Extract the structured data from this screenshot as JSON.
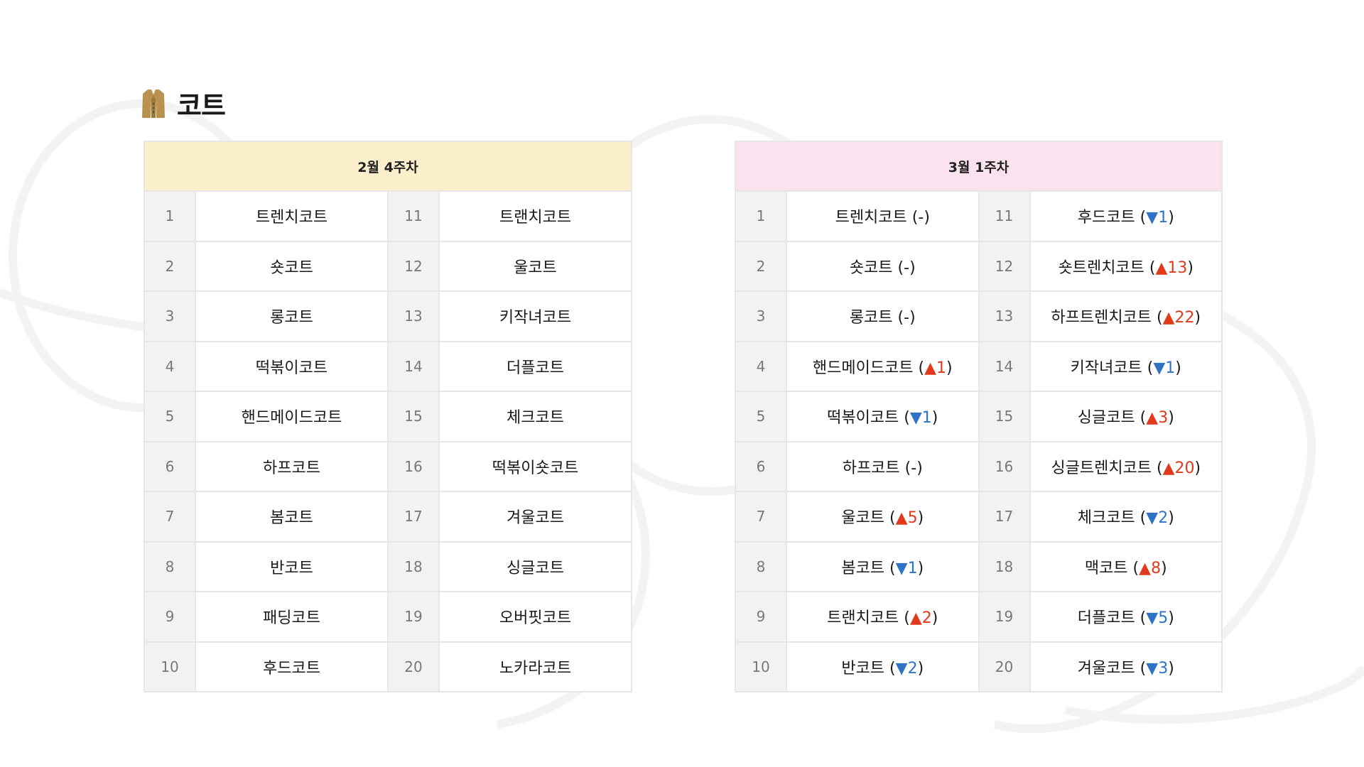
{
  "page": {
    "title": "코트",
    "icon": "coat-icon"
  },
  "colors": {
    "left_header_bg": "#fcf0cc",
    "right_header_bg": "#fae3ee",
    "up": "#e0391c",
    "down": "#2f73c4"
  },
  "left_table": {
    "header": "2월 4주차",
    "rows": [
      {
        "rank": "1",
        "name": "트렌치코트"
      },
      {
        "rank": "2",
        "name": "숏코트"
      },
      {
        "rank": "3",
        "name": "롱코트"
      },
      {
        "rank": "4",
        "name": "떡볶이코트"
      },
      {
        "rank": "5",
        "name": "핸드메이드코트"
      },
      {
        "rank": "6",
        "name": "하프코트"
      },
      {
        "rank": "7",
        "name": "봄코트"
      },
      {
        "rank": "8",
        "name": "반코트"
      },
      {
        "rank": "9",
        "name": "패딩코트"
      },
      {
        "rank": "10",
        "name": "후드코트"
      },
      {
        "rank": "11",
        "name": "트랜치코트"
      },
      {
        "rank": "12",
        "name": "울코트"
      },
      {
        "rank": "13",
        "name": "키작녀코트"
      },
      {
        "rank": "14",
        "name": "더플코트"
      },
      {
        "rank": "15",
        "name": "체크코트"
      },
      {
        "rank": "16",
        "name": "떡볶이숏코트"
      },
      {
        "rank": "17",
        "name": "겨울코트"
      },
      {
        "rank": "18",
        "name": "싱글코트"
      },
      {
        "rank": "19",
        "name": "오버핏코트"
      },
      {
        "rank": "20",
        "name": "노카라코트"
      }
    ]
  },
  "right_table": {
    "header": "3월 1주차",
    "rows": [
      {
        "rank": "1",
        "name": "트렌치코트",
        "dir": "same",
        "arrow": "",
        "change": "-"
      },
      {
        "rank": "2",
        "name": "숏코트",
        "dir": "same",
        "arrow": "",
        "change": "-"
      },
      {
        "rank": "3",
        "name": "롱코트",
        "dir": "same",
        "arrow": "",
        "change": "-"
      },
      {
        "rank": "4",
        "name": "핸드메이드코트",
        "dir": "up",
        "arrow": "▲",
        "change": "1"
      },
      {
        "rank": "5",
        "name": "떡볶이코트",
        "dir": "down",
        "arrow": "▼",
        "change": "1"
      },
      {
        "rank": "6",
        "name": "하프코트",
        "dir": "same",
        "arrow": "",
        "change": "-"
      },
      {
        "rank": "7",
        "name": "울코트",
        "dir": "up",
        "arrow": "▲",
        "change": "5"
      },
      {
        "rank": "8",
        "name": "봄코트",
        "dir": "down",
        "arrow": "▼",
        "change": "1"
      },
      {
        "rank": "9",
        "name": "트랜치코트",
        "dir": "up",
        "arrow": "▲",
        "change": "2"
      },
      {
        "rank": "10",
        "name": "반코트",
        "dir": "down",
        "arrow": "▼",
        "change": "2"
      },
      {
        "rank": "11",
        "name": "후드코트",
        "dir": "down",
        "arrow": "▼",
        "change": "1"
      },
      {
        "rank": "12",
        "name": "숏트렌치코트",
        "dir": "up",
        "arrow": "▲",
        "change": "13"
      },
      {
        "rank": "13",
        "name": "하프트렌치코트",
        "dir": "up",
        "arrow": "▲",
        "change": "22"
      },
      {
        "rank": "14",
        "name": "키작녀코트",
        "dir": "down",
        "arrow": "▼",
        "change": "1"
      },
      {
        "rank": "15",
        "name": "싱글코트",
        "dir": "up",
        "arrow": "▲",
        "change": "3"
      },
      {
        "rank": "16",
        "name": "싱글트렌치코트",
        "dir": "up",
        "arrow": "▲",
        "change": "20"
      },
      {
        "rank": "17",
        "name": "체크코트",
        "dir": "down",
        "arrow": "▼",
        "change": "2"
      },
      {
        "rank": "18",
        "name": "맥코트",
        "dir": "up",
        "arrow": "▲",
        "change": "8"
      },
      {
        "rank": "19",
        "name": "더플코트",
        "dir": "down",
        "arrow": "▼",
        "change": "5"
      },
      {
        "rank": "20",
        "name": "겨울코트",
        "dir": "down",
        "arrow": "▼",
        "change": "3"
      }
    ]
  }
}
